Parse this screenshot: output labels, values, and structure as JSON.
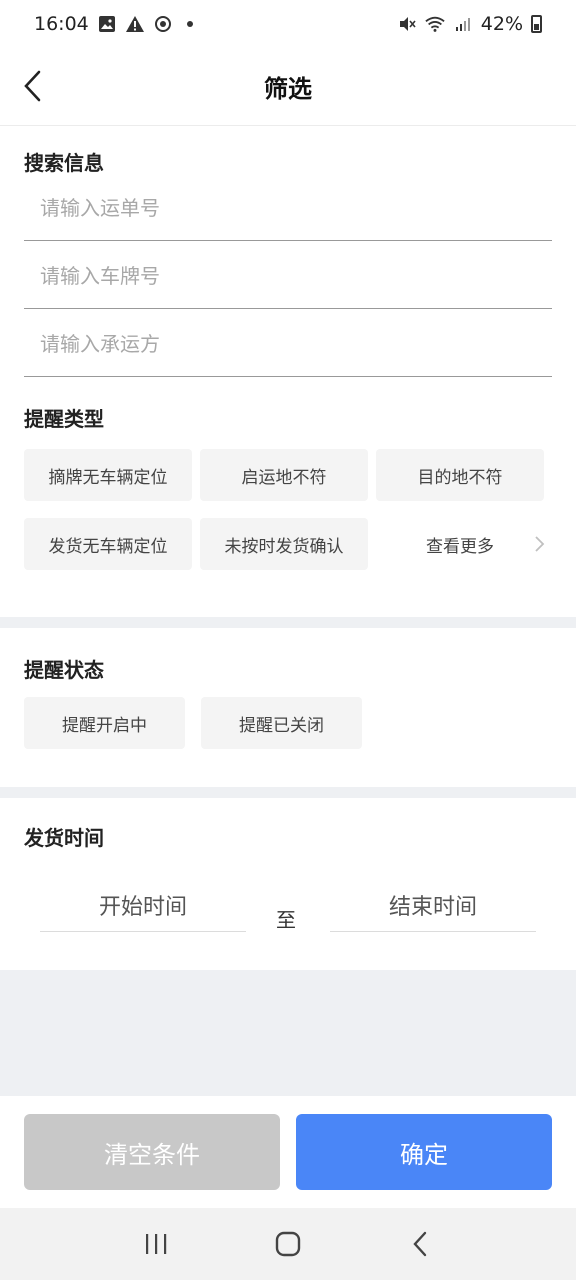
{
  "status_bar": {
    "time": "16:04",
    "battery_text": "42%",
    "icons_left": [
      "image-icon",
      "warning-icon",
      "sync-icon",
      "dot"
    ],
    "icons_right": [
      "mute-icon",
      "wifi-icon",
      "signal-icon",
      "battery-icon"
    ]
  },
  "header": {
    "title": "筛选",
    "back_icon": "chevron-left-icon"
  },
  "search": {
    "title": "搜索信息",
    "waybill_placeholder": "请输入运单号",
    "plate_placeholder": "请输入车牌号",
    "carrier_placeholder": "请输入承运方"
  },
  "reminder_type": {
    "title": "提醒类型",
    "chips": [
      "摘牌无车辆定位",
      "启运地不符",
      "目的地不符",
      "发货无车辆定位",
      "未按时发货确认"
    ],
    "more": "查看更多"
  },
  "reminder_status": {
    "title": "提醒状态",
    "chips": [
      "提醒开启中",
      "提醒已关闭"
    ]
  },
  "ship_time": {
    "title": "发货时间",
    "start": "开始时间",
    "to": "至",
    "end": "结束时间"
  },
  "footer": {
    "clear": "清空条件",
    "confirm": "确定"
  },
  "colors": {
    "primary": "#4a86f7",
    "disabled": "#c8c8c8",
    "chip_bg": "#f4f4f4",
    "divider": "#eef0f3"
  }
}
